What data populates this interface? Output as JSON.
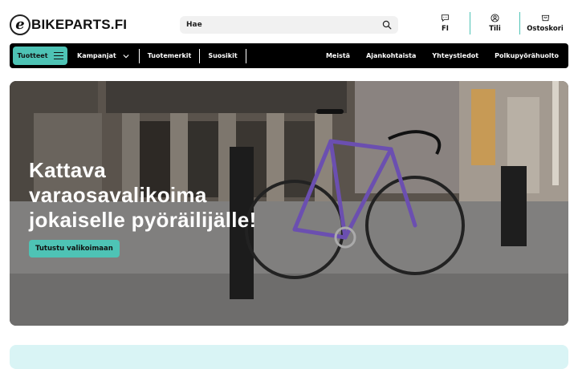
{
  "header": {
    "logo_initial": "e",
    "logo_text": "BIKEPARTS.FI",
    "search_placeholder": "Hae",
    "actions": [
      {
        "label": "FI",
        "icon": "language-chat-icon"
      },
      {
        "label": "Tili",
        "icon": "user-icon"
      },
      {
        "label": "Ostoskori",
        "icon": "cart-icon"
      }
    ]
  },
  "nav": {
    "products_label": "Tuotteet",
    "left_items": [
      "Kampanjat",
      "Tuotemerkit",
      "Suosikit"
    ],
    "right_items": [
      "Meistä",
      "Ajankohtaista",
      "Yhteystiedot",
      "Polkupyörähuolto"
    ]
  },
  "hero": {
    "lines": [
      "Kattava",
      "varaosavalikoima",
      "jokaiselle pyöräilijälle!"
    ],
    "button_label": "Tutustu valikoimaan"
  },
  "colors": {
    "accent": "#4ec3b5",
    "nav_bg": "#000000",
    "panel_bg": "#d9f4f5"
  }
}
